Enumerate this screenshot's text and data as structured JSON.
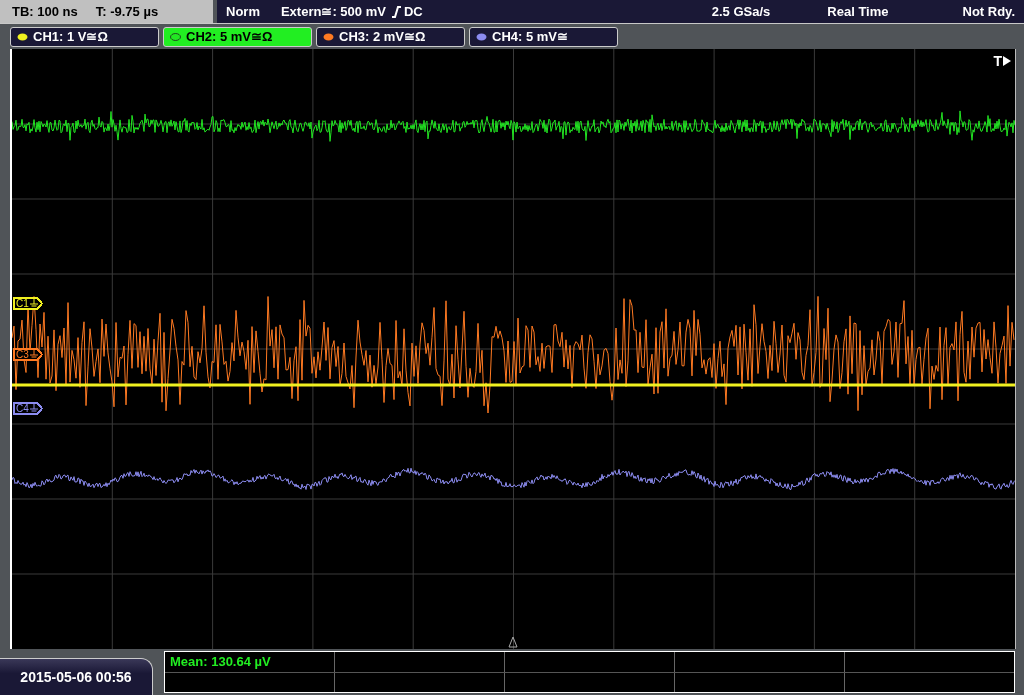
{
  "top_bar": {
    "timebase": "TB: 100 ns",
    "trigger_time": "T: -9.75 µs",
    "trigger_mode": "Norm",
    "trigger_source": "Extern≅: 500 mV",
    "coupling": "DC",
    "sample_rate": "2.5 GSa/s",
    "acquisition": "Real Time",
    "status": "Not Rdy."
  },
  "channels": [
    {
      "label": "CH1: 1 V≅Ω",
      "selected": false,
      "color": "#f0f020"
    },
    {
      "label": "CH2: 5 mV≅Ω",
      "selected": true,
      "color": "#22e622"
    },
    {
      "label": "CH3: 2 mV≅Ω",
      "selected": false,
      "color": "#ff7a22"
    },
    {
      "label": "CH4: 5 mV≅",
      "selected": false,
      "color": "#8c8cf0"
    }
  ],
  "markers": [
    {
      "label": "C1",
      "color": "#f0f020"
    },
    {
      "label": "C3",
      "color": "#ff7a22"
    },
    {
      "label": "C4",
      "color": "#8c8cf0"
    }
  ],
  "trigger_marker": "T",
  "measurement": "Mean: 130.64 µV",
  "datetime": "2015-05-06 00:56"
}
